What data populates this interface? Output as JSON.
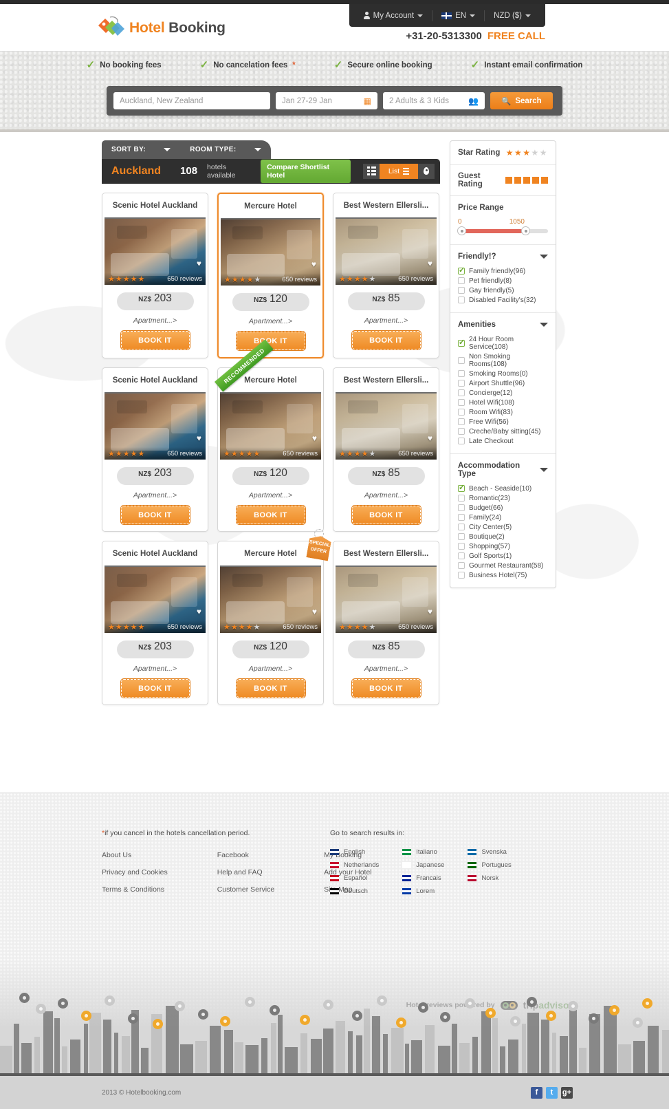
{
  "brand": {
    "name_light": "Hotel",
    "name_dark": "Booking"
  },
  "account_bar": {
    "my_account": "My Account",
    "language": "EN",
    "currency": "NZD ($)"
  },
  "phone": {
    "number": "+31-20-5313300",
    "free_call": "FREE CALL"
  },
  "features": [
    "No booking fees",
    "No cancelation fees",
    "Secure online booking",
    "Instant email confirmation"
  ],
  "search": {
    "destination_value": "Auckland, New Zealand",
    "dates_value": "Jan 27-29 Jan",
    "guests_value": "2 Adults & 3 Kids",
    "button_label": "Search"
  },
  "toolbar": {
    "sort_by": "SORT BY:",
    "room_type": "ROOM TYPE:",
    "city": "Auckland",
    "count": "108",
    "count_label": "hotels available",
    "compare_label": "Compare Shortlist Hotel",
    "view_list_label": "List"
  },
  "cards": [
    {
      "name": "Scenic Hotel Auckland",
      "currency": "NZ$",
      "price": "203",
      "stars": 5,
      "reviews": "650 reviews",
      "room": "Apartment...>",
      "book": "BOOK IT",
      "badge": "",
      "active": false,
      "photo": "ph-a"
    },
    {
      "name": "Mercure Hotel",
      "currency": "NZ$",
      "price": "120",
      "stars": 4,
      "reviews": "650 reviews",
      "room": "Apartment...>",
      "book": "BOOK IT",
      "badge": "",
      "active": true,
      "photo": "ph-b"
    },
    {
      "name": "Best Western Ellersli...",
      "currency": "NZ$",
      "price": "85",
      "stars": 4,
      "reviews": "650 reviews",
      "room": "Apartment...>",
      "book": "BOOK IT",
      "badge": "",
      "active": false,
      "photo": "ph-c"
    },
    {
      "name": "Scenic Hotel Auckland",
      "currency": "NZ$",
      "price": "203",
      "stars": 5,
      "reviews": "650 reviews",
      "room": "Apartment...>",
      "book": "BOOK IT",
      "badge": "",
      "active": false,
      "photo": "ph-a"
    },
    {
      "name": "Mercure Hotel",
      "currency": "NZ$",
      "price": "120",
      "stars": 5,
      "reviews": "650 reviews",
      "room": "Apartment...>",
      "book": "BOOK IT",
      "badge": "RECOMMENDED",
      "active": false,
      "photo": "ph-b"
    },
    {
      "name": "Best Western Ellersli...",
      "currency": "NZ$",
      "price": "85",
      "stars": 4,
      "reviews": "650 reviews",
      "room": "Apartment...>",
      "book": "BOOK IT",
      "badge": "",
      "active": false,
      "photo": "ph-c"
    },
    {
      "name": "Scenic Hotel Auckland",
      "currency": "NZ$",
      "price": "203",
      "stars": 5,
      "reviews": "650 reviews",
      "room": "Apartment...>",
      "book": "BOOK IT",
      "badge": "",
      "active": false,
      "photo": "ph-a"
    },
    {
      "name": "Mercure Hotel",
      "currency": "NZ$",
      "price": "120",
      "stars": 4,
      "reviews": "650 reviews",
      "room": "Apartment...>",
      "book": "BOOK IT",
      "badge": "SPECIAL OFFER",
      "active": false,
      "photo": "ph-b"
    },
    {
      "name": "Best Western Ellersli...",
      "currency": "NZ$",
      "price": "85",
      "stars": 4,
      "reviews": "650 reviews",
      "room": "Apartment...>",
      "book": "BOOK IT",
      "badge": "",
      "active": false,
      "photo": "ph-c"
    }
  ],
  "special_offer_text_1": "SPECIAL",
  "special_offer_text_2": "OFFER",
  "filters": {
    "star_rating_label": "Star Rating",
    "star_rating_value": 3,
    "guest_rating_label": "Guest Rating",
    "guest_rating_value": 5,
    "price_range_label": "Price Range",
    "price_min": "0",
    "price_max": "1050",
    "sections": [
      {
        "title": "Friendly!?",
        "options": [
          {
            "label": "Family friendly(96)",
            "checked": true
          },
          {
            "label": "Pet friendly(8)",
            "checked": false
          },
          {
            "label": "Gay friendly(5)",
            "checked": false
          },
          {
            "label": "Disabled Facility's(32)",
            "checked": false
          }
        ]
      },
      {
        "title": "Amenities",
        "options": [
          {
            "label": "24 Hour Room Service(108)",
            "checked": true
          },
          {
            "label": "Non Smoking Rooms(108)",
            "checked": false
          },
          {
            "label": "Smoking Rooms(0)",
            "checked": false
          },
          {
            "label": "Airport Shuttle(96)",
            "checked": false
          },
          {
            "label": "Concierge(12)",
            "checked": false
          },
          {
            "label": "Hotel Wifi(108)",
            "checked": false
          },
          {
            "label": "Room Wifi(83)",
            "checked": false
          },
          {
            "label": "Free Wifi(56)",
            "checked": false
          },
          {
            "label": "Creche/Baby sitting(45)",
            "checked": false
          },
          {
            "label": "Late Checkout",
            "checked": false
          }
        ]
      },
      {
        "title": "Accommodation Type",
        "options": [
          {
            "label": "Beach - Seaside(10)",
            "checked": true
          },
          {
            "label": "Romantic(23)",
            "checked": false
          },
          {
            "label": "Budget(66)",
            "checked": false
          },
          {
            "label": "Family(24)",
            "checked": false
          },
          {
            "label": "City Center(5)",
            "checked": false
          },
          {
            "label": "Boutique(2)",
            "checked": false
          },
          {
            "label": "Shopping(57)",
            "checked": false
          },
          {
            "label": "Golf Sports(1)",
            "checked": false
          },
          {
            "label": "Gourmet Restaurant(58)",
            "checked": false
          },
          {
            "label": "Business Hotel(75)",
            "checked": false
          }
        ]
      }
    ]
  },
  "footer": {
    "note": "if you cancel in the hotels cancellation period.",
    "columns": [
      [
        "About Us",
        "Privacy and Cookies",
        "Terms & Conditions"
      ],
      [
        "Facebook",
        "Help and FAQ",
        "Customer Service"
      ],
      [
        "My Booking",
        "Add your Hotel",
        "Site Map"
      ]
    ],
    "lang_title": "Go to search results in:",
    "languages": [
      [
        "English",
        "Netherlands",
        "Español",
        "Deutsch"
      ],
      [
        "Italiano",
        "Japanese",
        "Francais",
        "Lorem"
      ],
      [
        "Svenska",
        "Portugues",
        "Norsk"
      ]
    ],
    "lang_flag_colors": [
      [
        "#1b3a78",
        "#c8102e",
        "#c60b1e",
        "#000000"
      ],
      [
        "#009246",
        "#ffffff",
        "#002395",
        "#0039a6"
      ],
      [
        "#006aa7",
        "#006600",
        "#ba0c2f"
      ]
    ],
    "tripadvisor_text": "Hotel reviews powered by",
    "tripadvisor_brand_1": "trip",
    "tripadvisor_brand_2": "advisor",
    "copyright": "2013 ©  Hotelbooking.com",
    "social": [
      "f",
      "t",
      "g+"
    ]
  },
  "colors": {
    "accent": "#f08421",
    "dark": "#2f2f2f",
    "green": "#63a832"
  }
}
